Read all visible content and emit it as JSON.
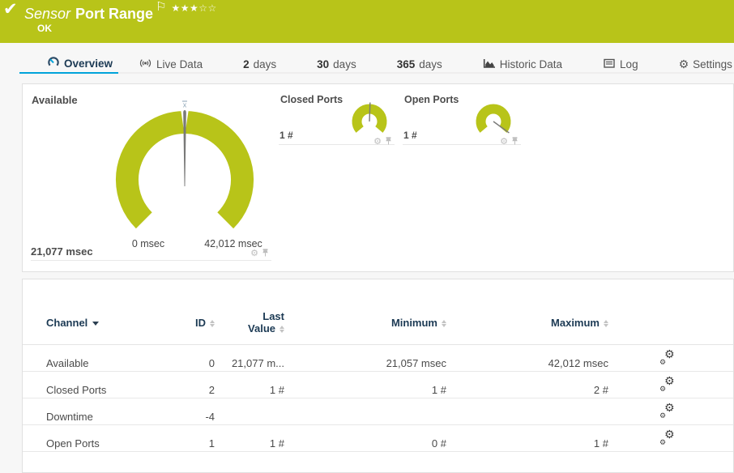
{
  "header": {
    "kind_label": "Sensor",
    "title": "Port Range",
    "status": "OK",
    "rating": {
      "filled": 3,
      "total": 5,
      "stars_filled": "★★★",
      "stars_empty": "☆☆"
    }
  },
  "tabs": [
    {
      "label": "Overview",
      "icon": "gauge-icon",
      "active": true
    },
    {
      "label": "Live Data",
      "icon": "broadcast-icon"
    },
    {
      "strong": "2",
      "label": "days"
    },
    {
      "strong": "30",
      "label": "days"
    },
    {
      "strong": "365",
      "label": "days"
    },
    {
      "label": "Historic Data",
      "icon": "area-chart-icon"
    },
    {
      "label": "Log",
      "icon": "log-icon"
    },
    {
      "label": "Settings",
      "icon": "gear-icon"
    }
  ],
  "gauges": {
    "arc_color": "#b8c419",
    "needle_color": "#797978",
    "available": {
      "label": "Available",
      "value": "21,077 msec",
      "min_label": "0 msec",
      "max_label": "42,012 msec",
      "mean_marker": "x",
      "needle_angle_deg": 0
    },
    "closed_ports": {
      "label": "Closed Ports",
      "value": "1 #",
      "needle_angle_deg": 2
    },
    "open_ports": {
      "label": "Open Ports",
      "value": "1 #",
      "needle_angle_deg": 126
    }
  },
  "table": {
    "columns": [
      {
        "label": "Channel",
        "sorted": "desc"
      },
      {
        "label": "ID"
      },
      {
        "label": "Last Value",
        "line1": "Last",
        "line2": "Value"
      },
      {
        "label": "Minimum"
      },
      {
        "label": "Maximum"
      },
      {
        "label": ""
      }
    ],
    "rows": [
      {
        "channel": "Available",
        "id": "0",
        "last": "21,077 m...",
        "min": "21,057 msec",
        "max": "42,012 msec"
      },
      {
        "channel": "Closed Ports",
        "id": "2",
        "last": "1 #",
        "min": "1 #",
        "max": "2 #"
      },
      {
        "channel": "Downtime",
        "id": "-4",
        "last": "",
        "min": "",
        "max": ""
      },
      {
        "channel": "Open Ports",
        "id": "1",
        "last": "1 #",
        "min": "0 #",
        "max": "1 #"
      }
    ]
  }
}
